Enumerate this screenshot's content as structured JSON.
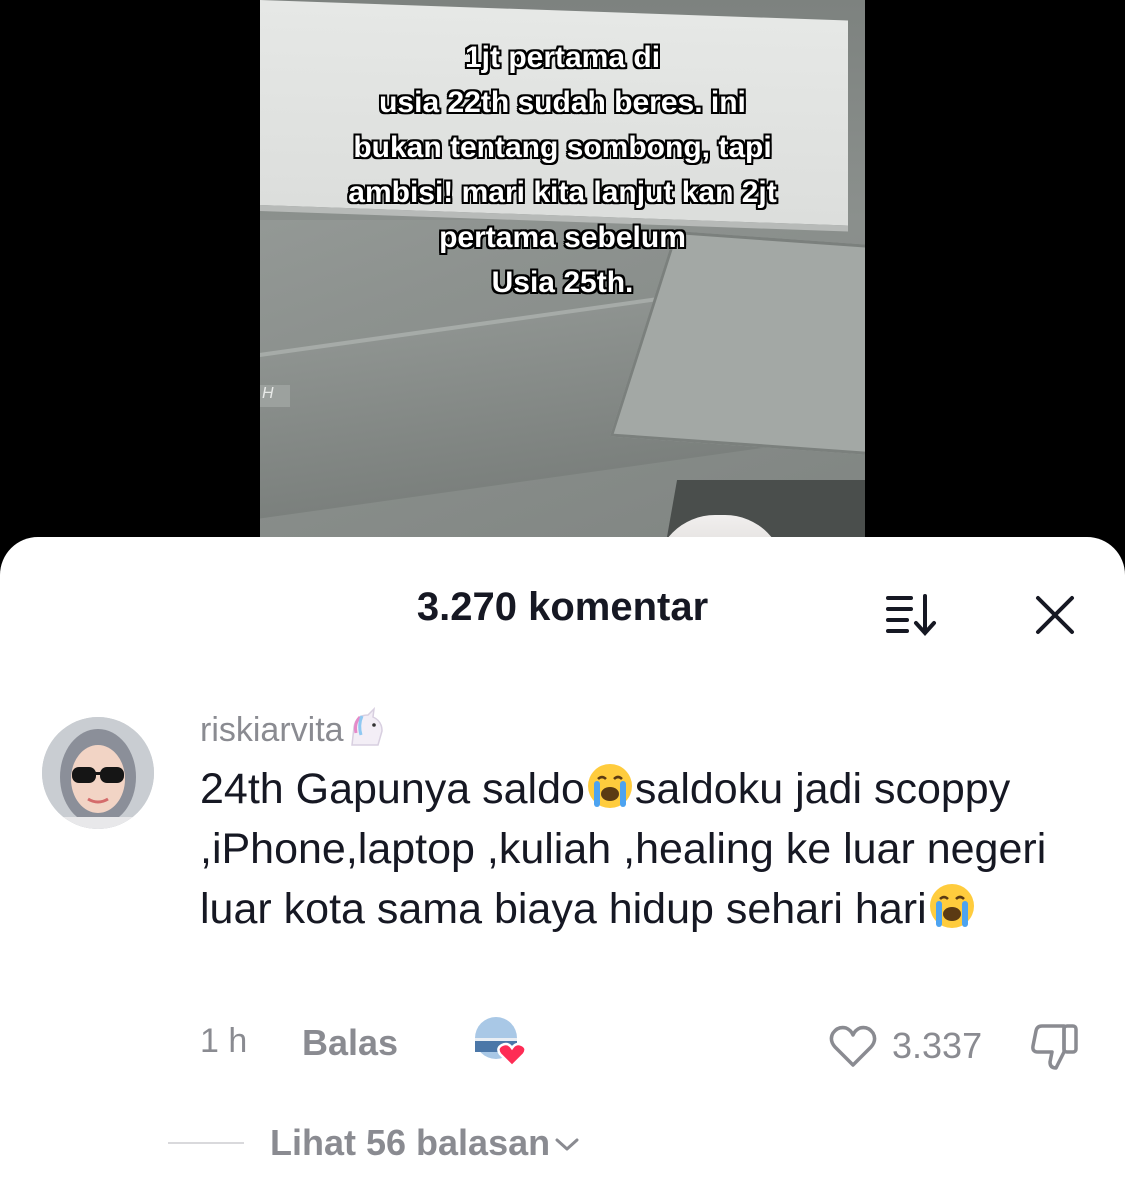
{
  "video": {
    "caption": "1jt pertama di\nusia 22th sudah beres. ini\nbukan tentang sombong, tapi\nambisi! mari kita lanjut kan 2jt\npertama sebelum\nUsia 25th.",
    "slot_label": "H"
  },
  "sheet": {
    "title": "3.270 komentar",
    "sort_icon": "sort-icon",
    "close_icon": "close-icon"
  },
  "comment": {
    "username": "riskiarvita",
    "username_emoji": "unicorn",
    "text_part1": "24th Gapunya saldo",
    "text_emoji1": "loudly-crying-face",
    "text_part2": "saldoku jadi scoppy ,iPhone,laptop ,kuliah ,healing ke luar negeri luar kota sama biaya hidup sehari hari",
    "text_emoji2": "loudly-crying-face",
    "time": "1 h",
    "reply_label": "Balas",
    "like_count": "3.337",
    "view_replies_label": "Lihat 56 balasan",
    "colors": {
      "secondary_text": "#8a8b91",
      "primary_text": "#161823",
      "heart": "#fe2c55"
    }
  }
}
